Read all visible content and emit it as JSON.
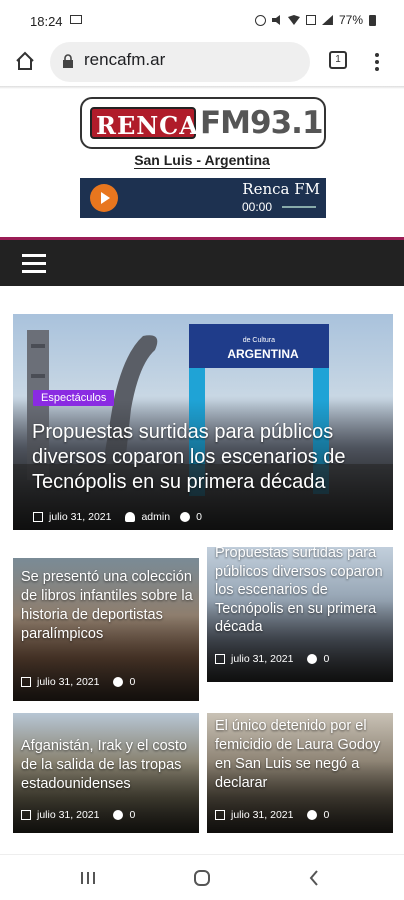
{
  "status": {
    "time": "18:24",
    "battery": "77%"
  },
  "browser": {
    "url": "rencafm.ar",
    "tab_count": "1"
  },
  "site": {
    "logo_left": "RENCA",
    "logo_right": "FM93.1",
    "subtitle": "San Luis - Argentina"
  },
  "player": {
    "station": "Renca FM",
    "time": "00:00"
  },
  "featured": {
    "badge": "Espectáculos",
    "title": "Propuestas surtidas para públicos diversos coparon los escenarios de Tecnópolis en su primera década",
    "date": "julio 31, 2021",
    "author": "admin",
    "comments": "0",
    "sign_text": "ARGENTINA",
    "sign_small": "de Cultura"
  },
  "articles": [
    {
      "title": "Se presentó una colección de libros infantiles sobre la historia de deportistas paralímpicos",
      "date": "julio 31, 2021",
      "comments": "0"
    },
    {
      "title": "Propuestas surtidas para públicos diversos coparon los escenarios de Tecnópolis en su primera década",
      "date": "julio 31, 2021",
      "comments": "0"
    },
    {
      "title": "Afganistán, Irak y el costo de la salida de las tropas estadounidenses",
      "date": "julio 31, 2021",
      "comments": "0"
    },
    {
      "title": "El único detenido por el femicidio de Laura Godoy en San Luis se negó a declarar",
      "date": "julio 31, 2021",
      "comments": "0"
    }
  ],
  "colors": {
    "nav": "#222222",
    "accent_line": "#9a1c55",
    "badge": "#8a2be2",
    "logo_red": "#b01c2a",
    "player_bg": "#1d3150",
    "play_orange": "#e8761e"
  }
}
